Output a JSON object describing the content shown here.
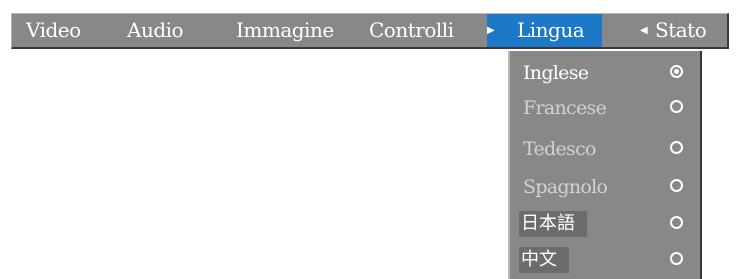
{
  "menubar": {
    "items": [
      {
        "label": "Video"
      },
      {
        "label": "Audio"
      },
      {
        "label": "Immagine"
      },
      {
        "label": "Controlli"
      },
      {
        "label": "Lingua"
      },
      {
        "label": "Stato"
      }
    ],
    "active_item": "Lingua"
  },
  "language_menu": {
    "options": [
      {
        "label": "Inglese",
        "selected": true
      },
      {
        "label": "Francese",
        "selected": false
      },
      {
        "label": "Tedesco",
        "selected": false
      },
      {
        "label": "Spagnolo",
        "selected": false
      },
      {
        "label": "日本語",
        "selected": false
      },
      {
        "label": "中文",
        "selected": false
      }
    ]
  },
  "colors": {
    "menu_background": "#888888",
    "active_highlight": "#1e78c8",
    "text": "#ffffff",
    "dim_text": "#d2d2d2"
  },
  "icons": {
    "prev_arrow": "triangle-right-icon",
    "next_arrow": "triangle-left-icon",
    "radio_checked": "radio-checked-icon",
    "radio_unchecked": "radio-unchecked-icon"
  }
}
